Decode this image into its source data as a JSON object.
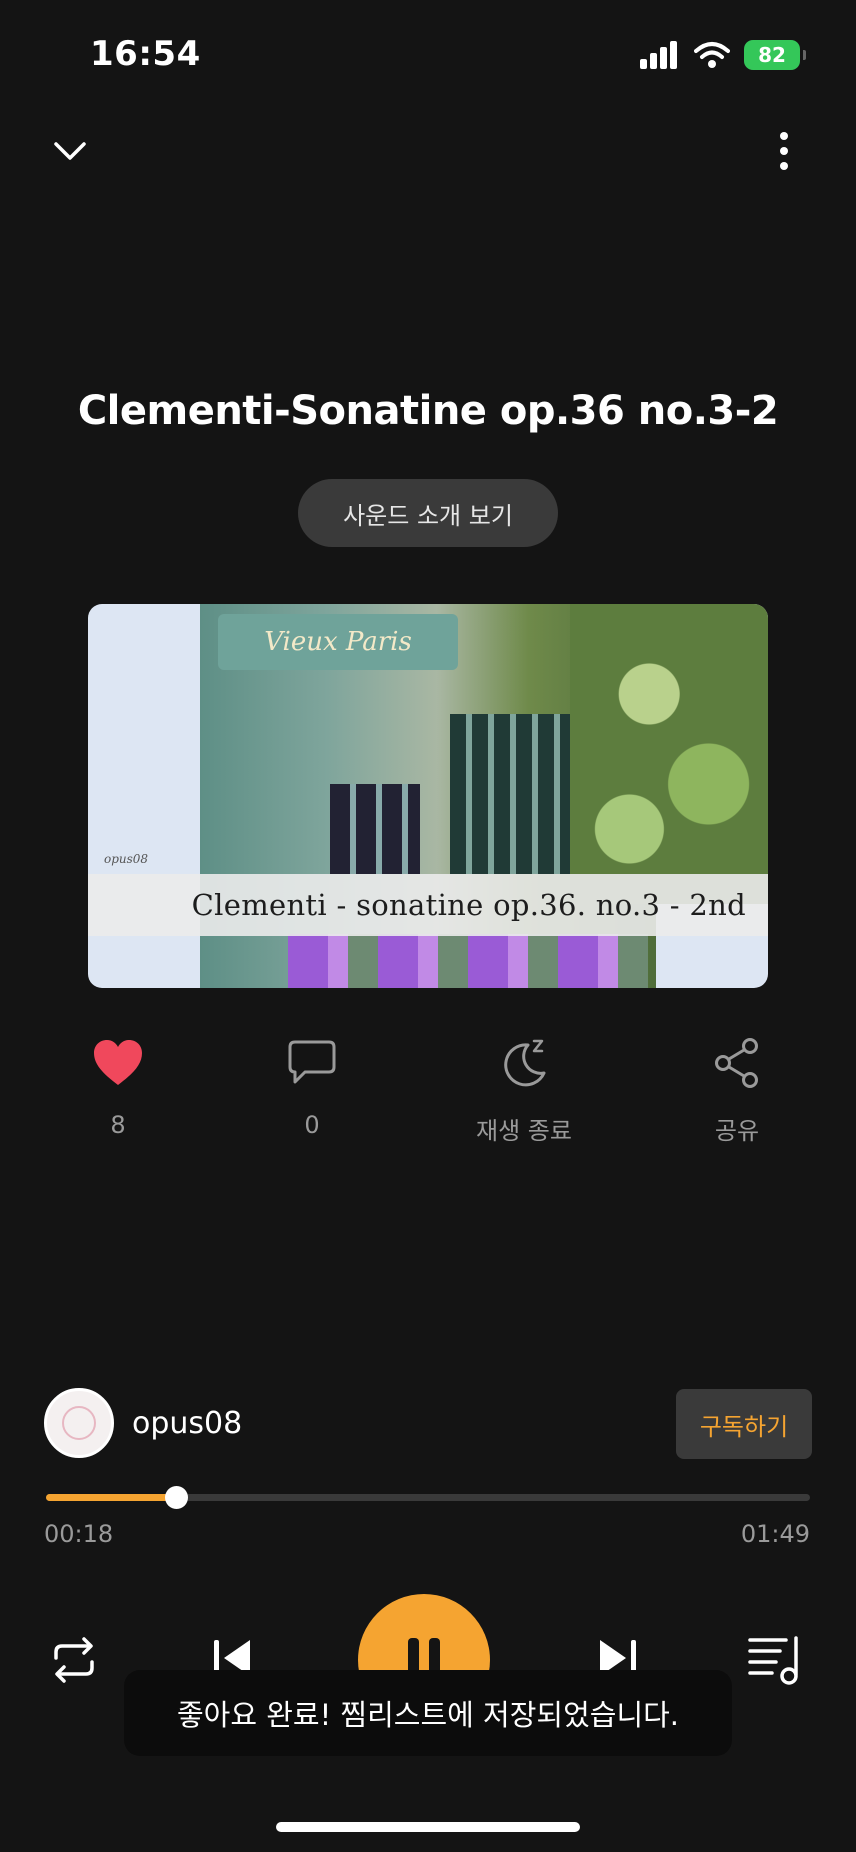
{
  "status_bar": {
    "time": "16:54",
    "battery": "82"
  },
  "track": {
    "title": "Clementi-Sonatine op.36 no.3-2",
    "intro_button": "사운드 소개 보기",
    "artwork_caption": "Clementi - sonatine op.36. no.3 - 2nd",
    "artwork_sign": "Vieux Paris",
    "artwork_watermark": "opus08"
  },
  "actions": {
    "like_count": "8",
    "comment_count": "0",
    "sleep_timer_label": "재생 종료",
    "share_label": "공유"
  },
  "channel": {
    "name": "opus08",
    "subscribe_label": "구독하기"
  },
  "playback": {
    "current_time": "00:18",
    "total_time": "01:49",
    "progress": 0.17
  },
  "toast": {
    "message": "좋아요 완료! 찜리스트에 저장되었습니다."
  },
  "colors": {
    "background": "#141414",
    "accent": "#f5a431",
    "like": "#f0485c",
    "battery": "#34c759"
  }
}
